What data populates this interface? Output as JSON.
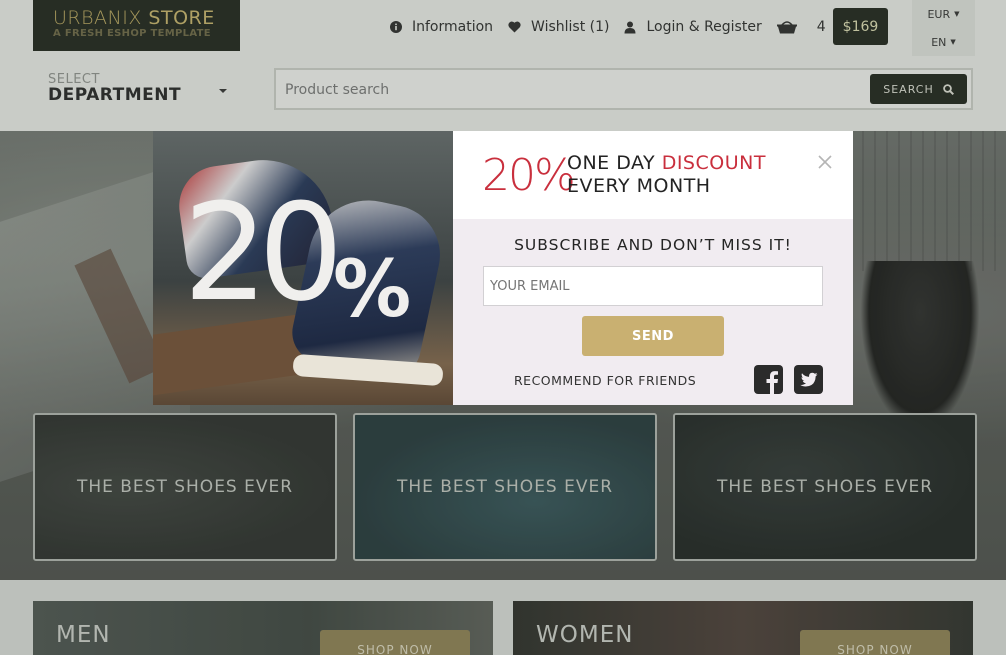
{
  "header": {
    "logo": {
      "brand_a": "URBANIX",
      "brand_b": " STORE",
      "tagline": "A FRESH ESHOP TEMPLATE"
    },
    "nav": {
      "information": "Information",
      "wishlist": "Wishlist (1)",
      "login": "Login & Register",
      "cart_count": "4",
      "cart_total": "$169"
    },
    "currency": "EUR",
    "language": "EN",
    "department": {
      "small": "SELECT",
      "big": "DEPARTMENT"
    },
    "search": {
      "placeholder": "Product search",
      "button": "SEARCH"
    }
  },
  "hero": {
    "cards": [
      {
        "label": "THE BEST SHOES EVER"
      },
      {
        "label": "THE BEST SHOES EVER"
      },
      {
        "label": "THE BEST SHOES EVER"
      }
    ]
  },
  "categories": [
    {
      "name": "MEN",
      "button": "SHOP NOW"
    },
    {
      "name": "WOMEN",
      "button": "SHOP NOW"
    }
  ],
  "modal": {
    "image_big": "20",
    "image_pct": "%",
    "percent": "20%",
    "line1_a": "ONE DAY ",
    "line1_b": "DISCOUNT",
    "line2": "EVERY MONTH",
    "subscribe_title": "SUBSCRIBE AND DON’T MISS IT!",
    "email_placeholder": "YOUR EMAIL",
    "send": "SEND",
    "recommend": "RECOMMEND FOR FRIENDS"
  },
  "colors": {
    "accent_red": "#c92f3d",
    "gold": "#c9b071",
    "dark": "#1f241c"
  },
  "icons": [
    "info-icon",
    "heart-icon",
    "user-icon",
    "basket-icon",
    "search-icon",
    "close-icon",
    "facebook-icon",
    "twitter-icon",
    "caret-down-icon"
  ]
}
